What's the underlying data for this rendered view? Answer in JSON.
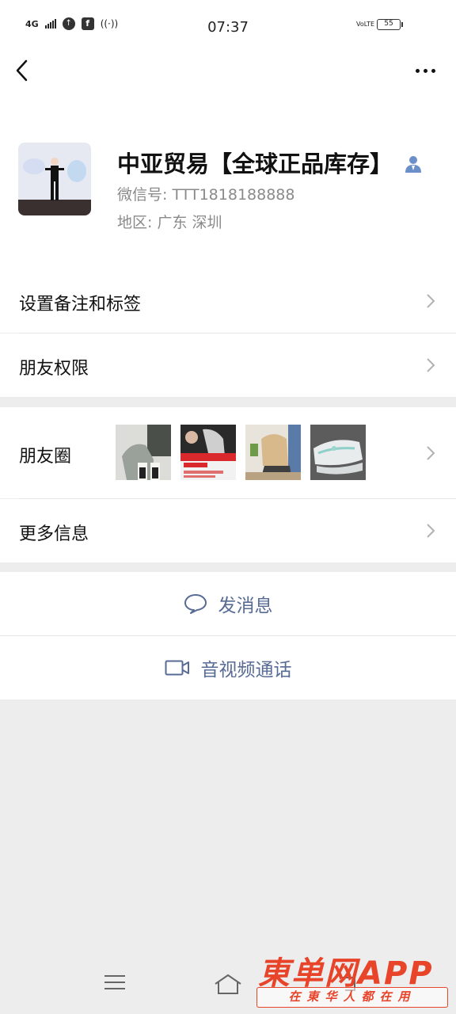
{
  "status_bar": {
    "network": "4G",
    "time": "07:37",
    "volte": "VoLTE",
    "battery": "55"
  },
  "profile": {
    "name": "中亚贸易【全球正品库存】",
    "wechat_id": "微信号: TTT1818188888",
    "region": "地区: 广东  深圳"
  },
  "rows": {
    "remark": "设置备注和标签",
    "permissions": "朋友权限",
    "moments": "朋友圈",
    "more_info": "更多信息"
  },
  "actions": {
    "send_message": "发消息",
    "video_call": "音视频通话"
  },
  "watermark": {
    "title": "東单网APP",
    "subtitle": "在東华人都在用"
  },
  "colors": {
    "link_blue": "#576b95",
    "background": "#ededed",
    "watermark_red": "#e8442a"
  },
  "icons": [
    "back-arrow-icon",
    "more-dots-icon",
    "verified-user-icon",
    "chevron-right-icon",
    "message-bubble-icon",
    "video-camera-icon",
    "menu-icon",
    "home-icon",
    "back-nav-icon"
  ]
}
